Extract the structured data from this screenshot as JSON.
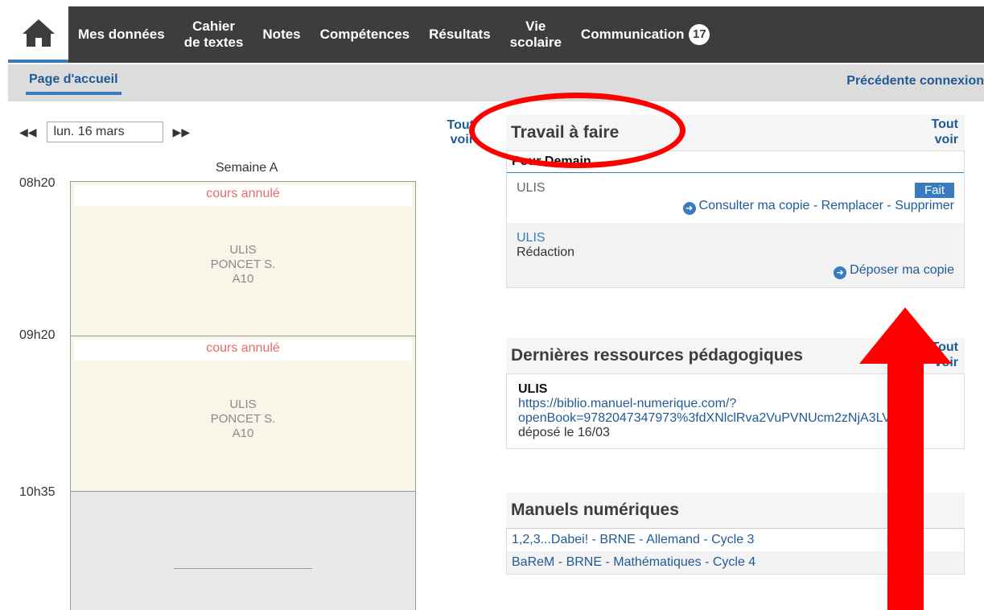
{
  "nav": {
    "items": [
      {
        "label": "Mes données"
      },
      {
        "label_line1": "Cahier",
        "label_line2": "de textes"
      },
      {
        "label": "Notes"
      },
      {
        "label": "Compétences"
      },
      {
        "label": "Résultats"
      },
      {
        "label_line1": "Vie",
        "label_line2": "scolaire"
      },
      {
        "label": "Communication",
        "badge": "17"
      }
    ]
  },
  "subbar": {
    "home_tab": "Page d'accueil",
    "previous_connection": "Précédente connexion"
  },
  "calendar": {
    "date": "lun. 16 mars",
    "tout_voir_line1": "Tout",
    "tout_voir_line2": "voir",
    "week": "Semaine A",
    "times": [
      "08h20",
      "09h20",
      "10h35"
    ],
    "slots": [
      {
        "status": "cours annulé",
        "subject": "ULIS",
        "teacher": "PONCET S.",
        "room": "A10"
      },
      {
        "status": "cours annulé",
        "subject": "ULIS",
        "teacher": "PONCET S.",
        "room": "A10"
      }
    ]
  },
  "homework": {
    "title": "Travail à faire",
    "tout_voir_line1": "Tout",
    "tout_voir_line2": "voir",
    "section": "Pour Demain",
    "items": [
      {
        "subject": "ULIS",
        "badge": "Fait",
        "link1": "Consulter ma copie",
        "link2": "Remplacer",
        "link3": "Supprimer",
        "sep": " - "
      },
      {
        "subject": "ULIS",
        "detail": "Rédaction",
        "link": "Déposer ma copie"
      }
    ]
  },
  "resources": {
    "title": "Dernières ressources pédagogiques",
    "tout_voir_line1": "Tout",
    "tout_voir_line2": "voir",
    "subject": "ULIS",
    "link_line1": "https://biblio.manuel-numerique.com/?",
    "link_line2": "openBook=9782047347973%3fdXNlclRva2VuPVNUcm2zNjA3LVN",
    "deposited": "déposé le 16/03"
  },
  "manuals": {
    "title": "Manuels numériques",
    "items": [
      "1,2,3...Dabei! - BRNE - Allemand - Cycle 3",
      "BaReM - BRNE - Mathématiques - Cycle 4"
    ]
  },
  "colors": {
    "nav_bg": "#3d3d3d",
    "accent": "#3a7bbf",
    "link": "#1f5a96",
    "annotation": "#ff0000",
    "cancelled": "#e86b6b"
  }
}
